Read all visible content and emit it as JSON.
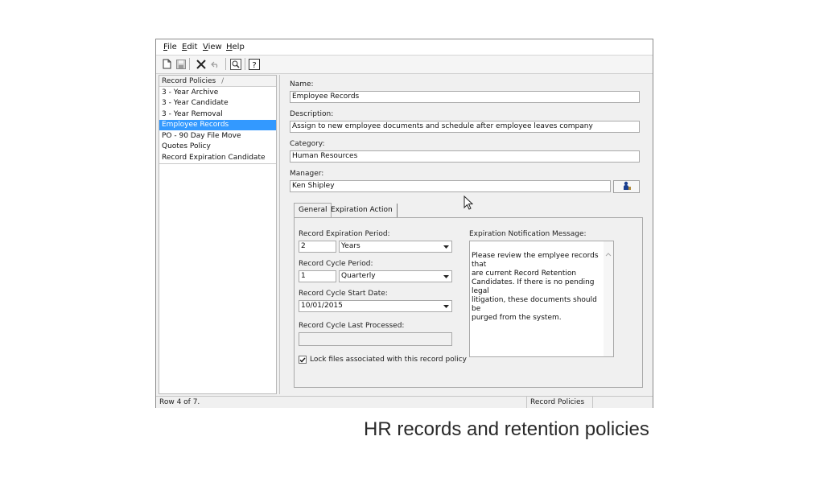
{
  "menu": {
    "items": [
      {
        "label": "File",
        "hotkey": "F"
      },
      {
        "label": "Edit",
        "hotkey": "E"
      },
      {
        "label": "View",
        "hotkey": "V"
      },
      {
        "label": "Help",
        "hotkey": "H"
      }
    ]
  },
  "toolbar": {
    "icons": [
      "new-document-icon",
      "save-icon",
      "delete-icon",
      "undo-icon",
      "find-icon",
      "help-icon"
    ]
  },
  "left_pane": {
    "header": "Record Policies",
    "sort_indicator": "/",
    "items": [
      {
        "label": "3 - Year Archive",
        "selected": false
      },
      {
        "label": "3 - Year Candidate",
        "selected": false
      },
      {
        "label": "3 - Year Removal",
        "selected": false
      },
      {
        "label": "Employee Records",
        "selected": true
      },
      {
        "label": "PO - 90 Day File Move",
        "selected": false
      },
      {
        "label": "Quotes Policy",
        "selected": false
      },
      {
        "label": "Record Expiration Candidate",
        "selected": false
      }
    ]
  },
  "form": {
    "name_label": "Name:",
    "name_value": "Employee Records",
    "description_label": "Description:",
    "description_value": "Assign to new employee documents and schedule after employee leaves company",
    "category_label": "Category:",
    "category_value": "Human Resources",
    "manager_label": "Manager:",
    "manager_value": "Ken Shipley",
    "manager_button_icon": "user-lookup-icon"
  },
  "tabs": [
    {
      "label": "General",
      "active": true
    },
    {
      "label": "Expiration Action",
      "active": false
    }
  ],
  "general": {
    "expiration_period_label": "Record Expiration Period:",
    "expiration_period_value": "2",
    "expiration_period_unit": "Years",
    "cycle_period_label": "Record Cycle Period:",
    "cycle_period_value": "1",
    "cycle_period_unit": "Quarterly",
    "cycle_start_label": "Record Cycle Start Date:",
    "cycle_start_value": "10/01/2015",
    "cycle_last_label": "Record Cycle Last Processed:",
    "cycle_last_value": "",
    "lock_label": "Lock files associated with this record policy",
    "lock_checked": true,
    "notification_label": "Expiration Notification Message:",
    "notification_message": "Please review the emplyee records that\nare current Record Retention\nCandidates. If there is no pending legal\nlitigation, these documents should be\npurged from the system."
  },
  "status": {
    "row": "Row 4 of 7.",
    "context": "Record Policies",
    "extra": ""
  },
  "caption": "HR records and retention policies"
}
